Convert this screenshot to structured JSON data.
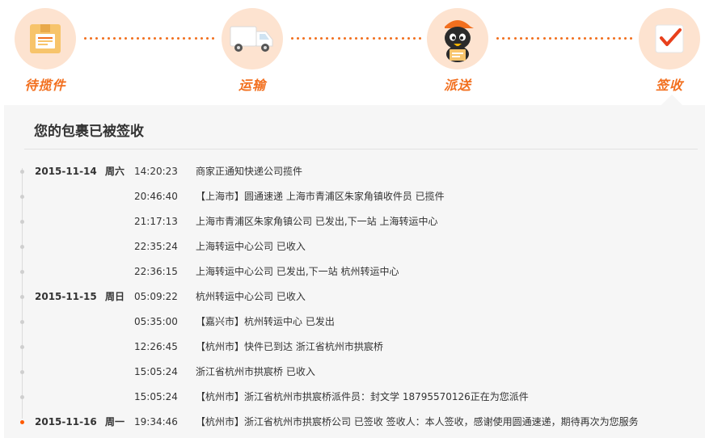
{
  "steps": [
    {
      "label": "待揽件",
      "icon": "package-icon"
    },
    {
      "label": "运输",
      "icon": "truck-icon"
    },
    {
      "label": "派送",
      "icon": "courier-penguin-icon"
    },
    {
      "label": "签收",
      "icon": "signed-check-icon"
    }
  ],
  "colors": {
    "accent": "#f26f1e",
    "circle_bg": "#fde3d0",
    "panel_bg": "#f6f6f6",
    "active_dot": "#ff5a00"
  },
  "panel": {
    "title": "您的包裹已被签收"
  },
  "tracking": [
    {
      "date": "2015-11-14",
      "weekday": "周六",
      "time": "14:20:23",
      "desc": "商家正通知快递公司揽件"
    },
    {
      "date": "",
      "weekday": "",
      "time": "20:46:40",
      "desc": "【上海市】圆通速递 上海市青浦区朱家角镇收件员 已揽件"
    },
    {
      "date": "",
      "weekday": "",
      "time": "21:17:13",
      "desc": "上海市青浦区朱家角镇公司 已发出,下一站 上海转运中心"
    },
    {
      "date": "",
      "weekday": "",
      "time": "22:35:24",
      "desc": "上海转运中心公司 已收入"
    },
    {
      "date": "",
      "weekday": "",
      "time": "22:36:15",
      "desc": "上海转运中心公司 已发出,下一站 杭州转运中心"
    },
    {
      "date": "2015-11-15",
      "weekday": "周日",
      "time": "05:09:22",
      "desc": "杭州转运中心公司 已收入"
    },
    {
      "date": "",
      "weekday": "",
      "time": "05:35:00",
      "desc": "【嘉兴市】杭州转运中心 已发出"
    },
    {
      "date": "",
      "weekday": "",
      "time": "12:26:45",
      "desc": "【杭州市】快件已到达 浙江省杭州市拱宸桥"
    },
    {
      "date": "",
      "weekday": "",
      "time": "15:05:24",
      "desc": "浙江省杭州市拱宸桥 已收入"
    },
    {
      "date": "",
      "weekday": "",
      "time": "15:05:24",
      "desc": "【杭州市】浙江省杭州市拱宸桥派件员：封文学 18795570126正在为您派件"
    },
    {
      "date": "2015-11-16",
      "weekday": "周一",
      "time": "19:34:46",
      "desc": "【杭州市】浙江省杭州市拱宸桥公司 已签收 签收人：本人签收，感谢使用圆通速递，期待再次为您服务"
    }
  ]
}
